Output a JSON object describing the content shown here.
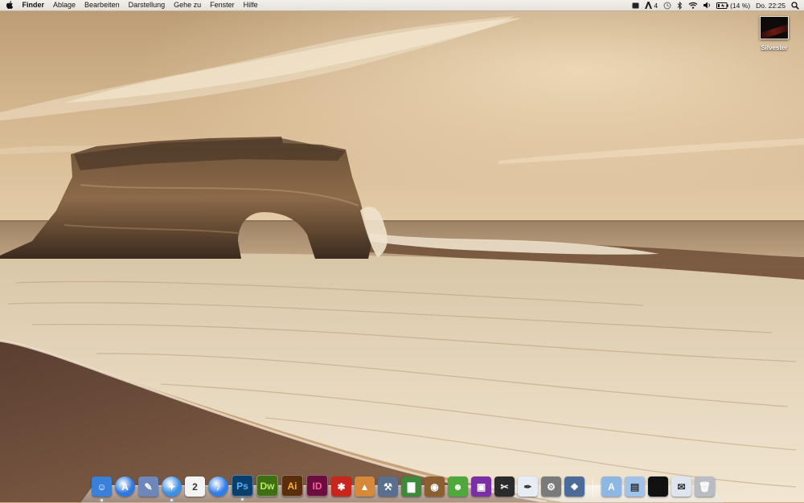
{
  "menubar": {
    "apple_icon": "apple-icon",
    "app_name": "Finder",
    "menus": [
      "Ablage",
      "Bearbeiten",
      "Darstellung",
      "Gehe zu",
      "Fenster",
      "Hilfe"
    ],
    "status": {
      "adobe_count": "4",
      "battery_text": "(14 %)",
      "clock": "Do. 22:25"
    }
  },
  "desktop": {
    "icons": [
      {
        "label": "Silvester",
        "kind": "image-file"
      }
    ]
  },
  "dock": {
    "items": [
      {
        "name": "finder",
        "icon": "finder-icon",
        "glyph": "☺",
        "color": "#3a7fd8",
        "round": false
      },
      {
        "name": "app-store",
        "icon": "app-store-icon",
        "glyph": "A",
        "color": "#2b78e0",
        "round": true
      },
      {
        "name": "preview",
        "icon": "preview-icon",
        "glyph": "✎",
        "color": "#6e86b8",
        "round": false
      },
      {
        "name": "safari",
        "icon": "safari-icon",
        "glyph": "✦",
        "color": "#3d8fe3",
        "round": true
      },
      {
        "name": "ical",
        "icon": "calendar-icon",
        "glyph": "2",
        "color": "#f4f4f4",
        "round": false
      },
      {
        "name": "itunes",
        "icon": "itunes-icon",
        "glyph": "♪",
        "color": "#2f7de6",
        "round": true
      },
      {
        "name": "photoshop",
        "icon": "photoshop-icon",
        "glyph": "Ps",
        "color": "#0b3f6b",
        "round": false
      },
      {
        "name": "dreamweaver",
        "icon": "dreamweaver-icon",
        "glyph": "Dw",
        "color": "#3f6e15",
        "round": false
      },
      {
        "name": "illustrator",
        "icon": "illustrator-icon",
        "glyph": "Ai",
        "color": "#5a2e0a",
        "round": false
      },
      {
        "name": "indesign",
        "icon": "indesign-icon",
        "glyph": "ID",
        "color": "#6a0f3d",
        "round": false
      },
      {
        "name": "acrobat",
        "icon": "acrobat-icon",
        "glyph": "✱",
        "color": "#c8261d",
        "round": false
      },
      {
        "name": "keynote",
        "icon": "keynote-icon",
        "glyph": "▲",
        "color": "#d7893a",
        "round": false
      },
      {
        "name": "xcode",
        "icon": "xcode-icon",
        "glyph": "⚒",
        "color": "#5a6f8e",
        "round": false
      },
      {
        "name": "numbers",
        "icon": "numbers-icon",
        "glyph": "▇",
        "color": "#3d8a3a",
        "round": false
      },
      {
        "name": "iphoto",
        "icon": "iphoto-icon",
        "glyph": "◉",
        "color": "#8b5f2f",
        "round": false
      },
      {
        "name": "adium",
        "icon": "adium-icon",
        "glyph": "☻",
        "color": "#4ea83b",
        "round": false
      },
      {
        "name": "photo-booth",
        "icon": "photo-booth-icon",
        "glyph": "▣",
        "color": "#7b2fa5",
        "round": false
      },
      {
        "name": "final-cut",
        "icon": "clapper-icon",
        "glyph": "✂",
        "color": "#2b2b2b",
        "round": false
      },
      {
        "name": "textedit",
        "icon": "textedit-icon",
        "glyph": "✒",
        "color": "#e8ecf4",
        "round": false
      },
      {
        "name": "system-preferences",
        "icon": "gear-icon",
        "glyph": "⚙",
        "color": "#7a7a7a",
        "round": false
      },
      {
        "name": "preview-photos",
        "icon": "photos-icon",
        "glyph": "❖",
        "color": "#4d6b99",
        "round": false
      }
    ],
    "stacks": [
      {
        "name": "applications-stack",
        "icon": "applications-folder-icon",
        "glyph": "A",
        "color": "#8fb7e4"
      },
      {
        "name": "documents-stack",
        "icon": "documents-folder-icon",
        "glyph": "▤",
        "color": "#9fc3ea"
      },
      {
        "name": "downloads-stack",
        "icon": "black-stack-icon",
        "glyph": "",
        "color": "#111111"
      },
      {
        "name": "mail-stack",
        "icon": "mail-stack-icon",
        "glyph": "✉",
        "color": "#dfe5ee"
      },
      {
        "name": "trash",
        "icon": "trash-icon",
        "glyph": "🗑",
        "color": "#b9bcc2"
      }
    ],
    "running": [
      "finder",
      "safari",
      "photoshop"
    ]
  },
  "colors": {
    "sky": "#c8a77c",
    "sea": "#a98d6b",
    "foam": "#e9dcc6",
    "sand": "#6e4f3c"
  }
}
